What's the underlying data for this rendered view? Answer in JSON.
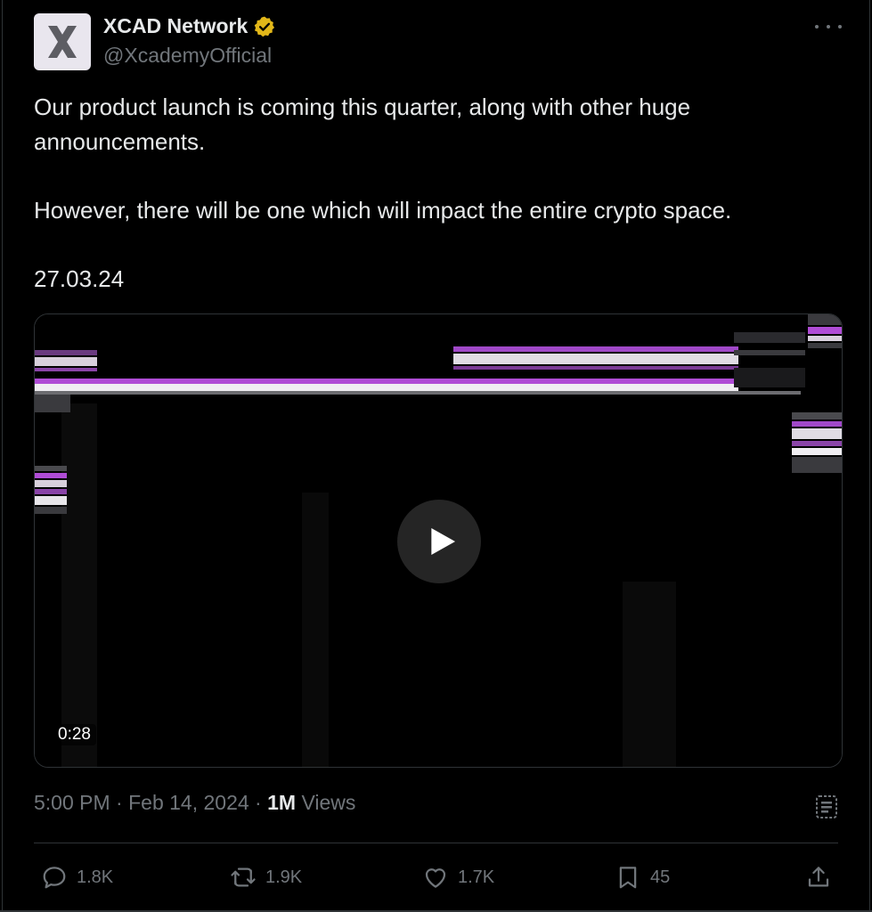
{
  "author": {
    "display_name": "XCAD Network",
    "handle": "@XcademyOfficial",
    "avatar_letter": "X",
    "verified_badge": "verified-gold-badge-icon"
  },
  "tweet": {
    "text": "Our product launch is coming this quarter, along with other huge announcements.\n\nHowever, there will be one which will impact the entire crypto space.\n\n27.03.24"
  },
  "media": {
    "type": "video",
    "duration": "0:28",
    "play_icon": "play-icon"
  },
  "meta": {
    "time": "5:00 PM",
    "separator": " · ",
    "date": "Feb 14, 2024",
    "views_count": "1M",
    "views_label": " Views"
  },
  "actions": {
    "replies": "1.8K",
    "reposts": "1.9K",
    "likes": "1.7K",
    "bookmarks": "45"
  },
  "colors": {
    "background": "#000000",
    "text": "#e7e9ea",
    "muted": "#71767b",
    "border": "#2f3336",
    "glitch_purple": "#b04cd6",
    "verified_gold": "#e2b719"
  }
}
